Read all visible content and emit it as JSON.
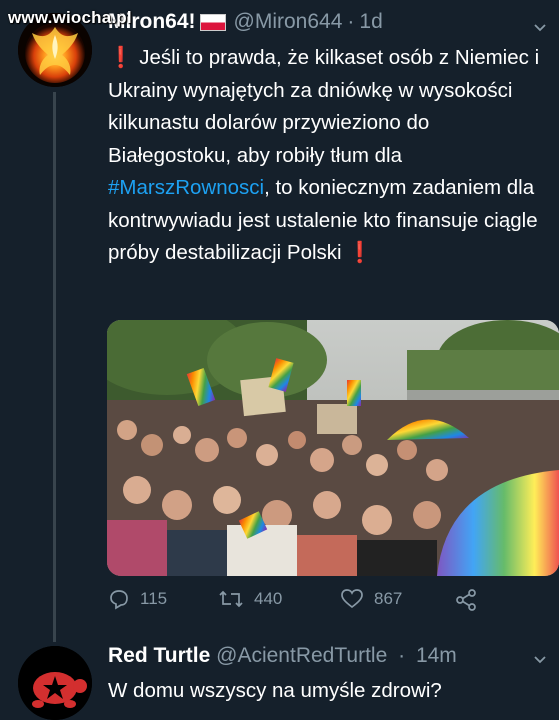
{
  "watermark": "www.wiocha.pl",
  "colors": {
    "background": "#15202b",
    "secondary_text": "#8899a6",
    "hashtag": "#1da1f2",
    "exclaim": "#e0245e",
    "thread_line": "#38444d"
  },
  "tweet": {
    "display_name": "Miron64!",
    "flag_icon": "poland-flag",
    "handle": "@Miron644",
    "separator": "·",
    "time": "1d",
    "emoji_leading": "❗",
    "text_part1": " Jeśli to prawda, że kilkaset osób z Niemiec i Ukrainy wynajętych za dniówkę w wysokości kilkunastu dolarów przywieziono do Białegostoku, aby robiły tłum dla ",
    "hashtag": "#MarszRownosci",
    "text_part2": ", to koniecznym zadaniem dla kontrwywiadu jest ustalenie kto finansuje ciągle próby destabilizacji Polski ",
    "emoji_trailing": "❗",
    "photo_icon": "crowd-march-photo",
    "actions": {
      "reply_count": "115",
      "retweet_count": "440",
      "like_count": "867",
      "share_icon": "share-icon"
    }
  },
  "reply": {
    "display_name": "Red Turtle",
    "handle": "@AcientRedTurtle",
    "separator": "·",
    "time": "14m",
    "text": "W domu wszyscy na umyśle zdrowi?"
  }
}
